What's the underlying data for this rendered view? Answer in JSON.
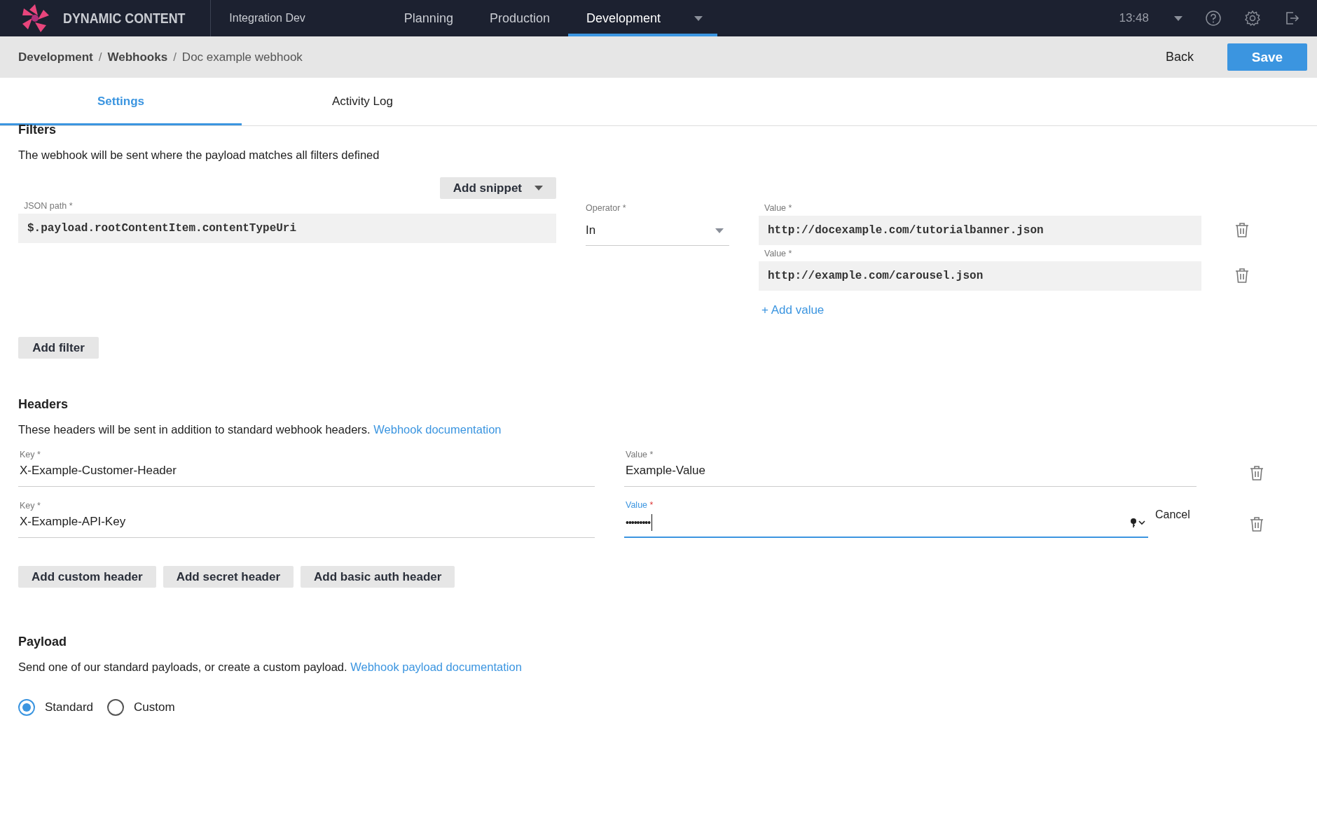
{
  "app": {
    "name": "DYNAMIC CONTENT",
    "hub": "Integration Dev"
  },
  "nav": [
    {
      "label": "Planning",
      "selected": false
    },
    {
      "label": "Production",
      "selected": false
    },
    {
      "label": "Development",
      "selected": true
    }
  ],
  "clock": "13:48",
  "breadcrumb": {
    "separator": "/",
    "items": [
      {
        "label": "Development",
        "current": false
      },
      {
        "label": "Webhooks",
        "current": false
      },
      {
        "label": "Doc example webhook",
        "current": true
      }
    ]
  },
  "actions": {
    "back": "Back",
    "save": "Save"
  },
  "tabs": [
    {
      "label": "Settings",
      "selected": true
    },
    {
      "label": "Activity Log",
      "selected": false
    }
  ],
  "filters": {
    "title": "Filters",
    "description": "The webhook will be sent where the payload matches all filters defined",
    "snippet_button": "Add snippet",
    "rows": [
      {
        "path_label": "JSON path",
        "path": "$.payload.rootContentItem.contentTypeUri",
        "operator_label": "Operator",
        "operator": "In",
        "add_value": "+ Add value",
        "values": [
          {
            "label": "Value",
            "value": "http://docexample.com/tutorialbanner.json"
          },
          {
            "label": "Value",
            "value": "http://example.com/carousel.json"
          }
        ]
      }
    ],
    "required": "*",
    "add_filter": "Add filter"
  },
  "headers": {
    "title": "Headers",
    "description": "These headers will be sent in addition to standard webhook headers.",
    "doc_link": "Webhook documentation",
    "rows": [
      {
        "key_label": "Key",
        "key": "X-Example-Customer-Header",
        "value_label": "Value",
        "value": "Example-Value",
        "kind": "plain",
        "focused": false
      },
      {
        "key_label": "Key",
        "key": "X-Example-API-Key",
        "value_label": "Value",
        "value": "•••••••••",
        "kind": "secret",
        "focused": true,
        "cancel": "Cancel"
      }
    ],
    "required": "*",
    "buttons": [
      "Add custom header",
      "Add secret header",
      "Add basic auth header"
    ]
  },
  "payload": {
    "title": "Payload",
    "description": "Send one of our standard payloads, or create a custom payload.",
    "doc_link": "Webhook payload documentation",
    "options": [
      {
        "label": "Standard",
        "selected": true
      },
      {
        "label": "Custom",
        "selected": false
      }
    ]
  }
}
